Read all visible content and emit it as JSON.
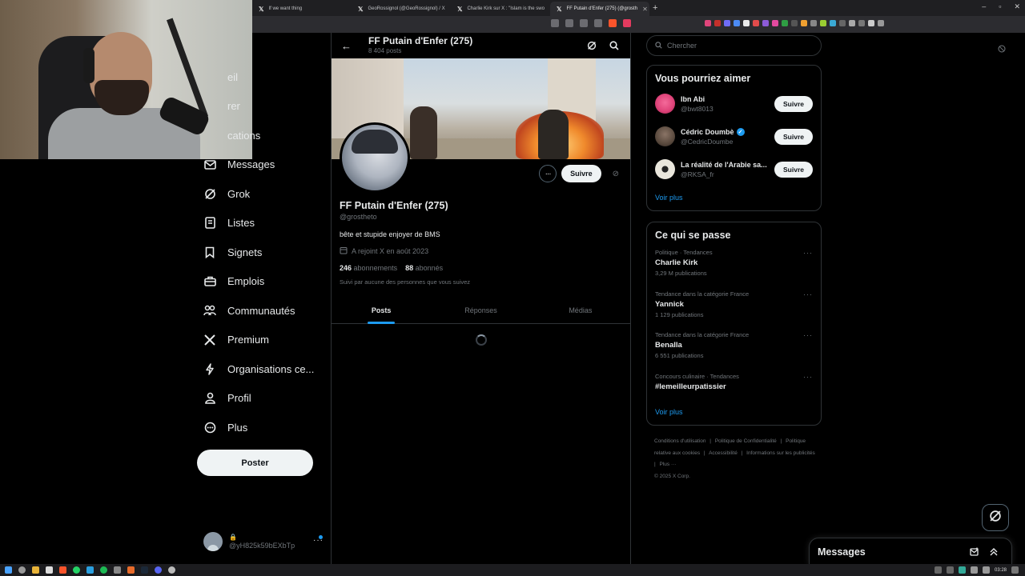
{
  "browser": {
    "tabs": [
      {
        "label": "If we want thing",
        "active": false
      },
      {
        "label": "GeoRossignol (@GeoRossignol) / X",
        "active": false
      },
      {
        "label": "Charlie Kirk sur X : \"Islam is the swo",
        "active": false
      },
      {
        "label": "FF Putain d'Enfer (275) (@grosth",
        "active": true
      }
    ],
    "new_tab": "+",
    "window_controls": [
      "–",
      "▫",
      "✕"
    ]
  },
  "nav": {
    "items": [
      {
        "label": "Accueil",
        "icon": "home-icon",
        "visible_label": "eil"
      },
      {
        "label": "Explorer",
        "icon": "search-icon",
        "visible_label": "rer"
      },
      {
        "label": "Notifications",
        "icon": "bell-icon",
        "visible_label": "cations"
      },
      {
        "label": "Messages",
        "icon": "mail-icon"
      },
      {
        "label": "Grok",
        "icon": "grok-icon"
      },
      {
        "label": "Listes",
        "icon": "list-icon"
      },
      {
        "label": "Signets",
        "icon": "bookmark-icon"
      },
      {
        "label": "Emplois",
        "icon": "briefcase-icon"
      },
      {
        "label": "Communautés",
        "icon": "people-icon"
      },
      {
        "label": "Premium",
        "icon": "x-logo-icon"
      },
      {
        "label": "Organisations ce...",
        "icon": "lightning-icon"
      },
      {
        "label": "Profil",
        "icon": "person-icon"
      },
      {
        "label": "Plus",
        "icon": "more-circle-icon"
      }
    ],
    "post_button": "Poster",
    "account": {
      "handle": "@yH825k59bEXbTp",
      "more": "···"
    }
  },
  "profile": {
    "header_name": "FF Putain d'Enfer (275)",
    "header_posts": "8 404 posts",
    "name": "FF Putain d'Enfer (275)",
    "handle": "@grostheto",
    "bio": "bête et stupide enjoyer de BMS",
    "joined": "A rejoint X en août 2023",
    "following_count": "246",
    "following_label": "abonnements",
    "followers_count": "88",
    "followers_label": "abonnés",
    "followed_by": "Suivi par aucune des personnes que vous suivez",
    "follow_button": "Suivre",
    "more_button": "···",
    "tabs": [
      {
        "label": "Posts",
        "active": true
      },
      {
        "label": "Réponses",
        "active": false
      },
      {
        "label": "Médias",
        "active": false
      }
    ]
  },
  "search": {
    "placeholder": "Chercher"
  },
  "suggestions": {
    "title": "Vous pourriez aimer",
    "items": [
      {
        "name": "Ibn Abi",
        "handle": "@bwt8013",
        "verified": false,
        "button": "Suivre",
        "avatar_color": "#e0457b"
      },
      {
        "name": "Cédric Doumbè",
        "handle": "@CedricDoumbe",
        "verified": true,
        "button": "Suivre",
        "avatar_color": "#5a4a3e"
      },
      {
        "name": "La réalité de l'Arabie sa...",
        "handle": "@RKSA_fr",
        "verified": false,
        "button": "Suivre",
        "avatar_color": "#e9e6dc"
      }
    ],
    "more": "Voir plus"
  },
  "trends": {
    "title": "Ce qui se passe",
    "items": [
      {
        "context": "Politique · Tendances",
        "name": "Charlie Kirk",
        "count": "3,29 M publications"
      },
      {
        "context": "Tendance dans la catégorie France",
        "name": "Yannick",
        "count": "1 129 publications"
      },
      {
        "context": "Tendance dans la catégorie France",
        "name": "Benalla",
        "count": "6 551 publications"
      },
      {
        "context": "Concours culinaire · Tendances",
        "name": "#lemeilleurpatissier",
        "count": ""
      }
    ],
    "more": "Voir plus"
  },
  "footer": {
    "links": [
      "Conditions d'utilisation",
      "|",
      "Politique de Confidentialité",
      "|",
      "Politique relative aux cookies",
      "|",
      "Accessibilité",
      "|",
      "Informations sur les publicités",
      "|",
      "Plus ···"
    ],
    "copyright": "© 2025 X Corp."
  },
  "messages_drawer": {
    "title": "Messages"
  },
  "taskbar": {
    "time": "03:28"
  },
  "colors": {
    "accent": "#1d9bf0",
    "background": "#000000",
    "border": "#2f3336",
    "muted": "#71767b"
  }
}
